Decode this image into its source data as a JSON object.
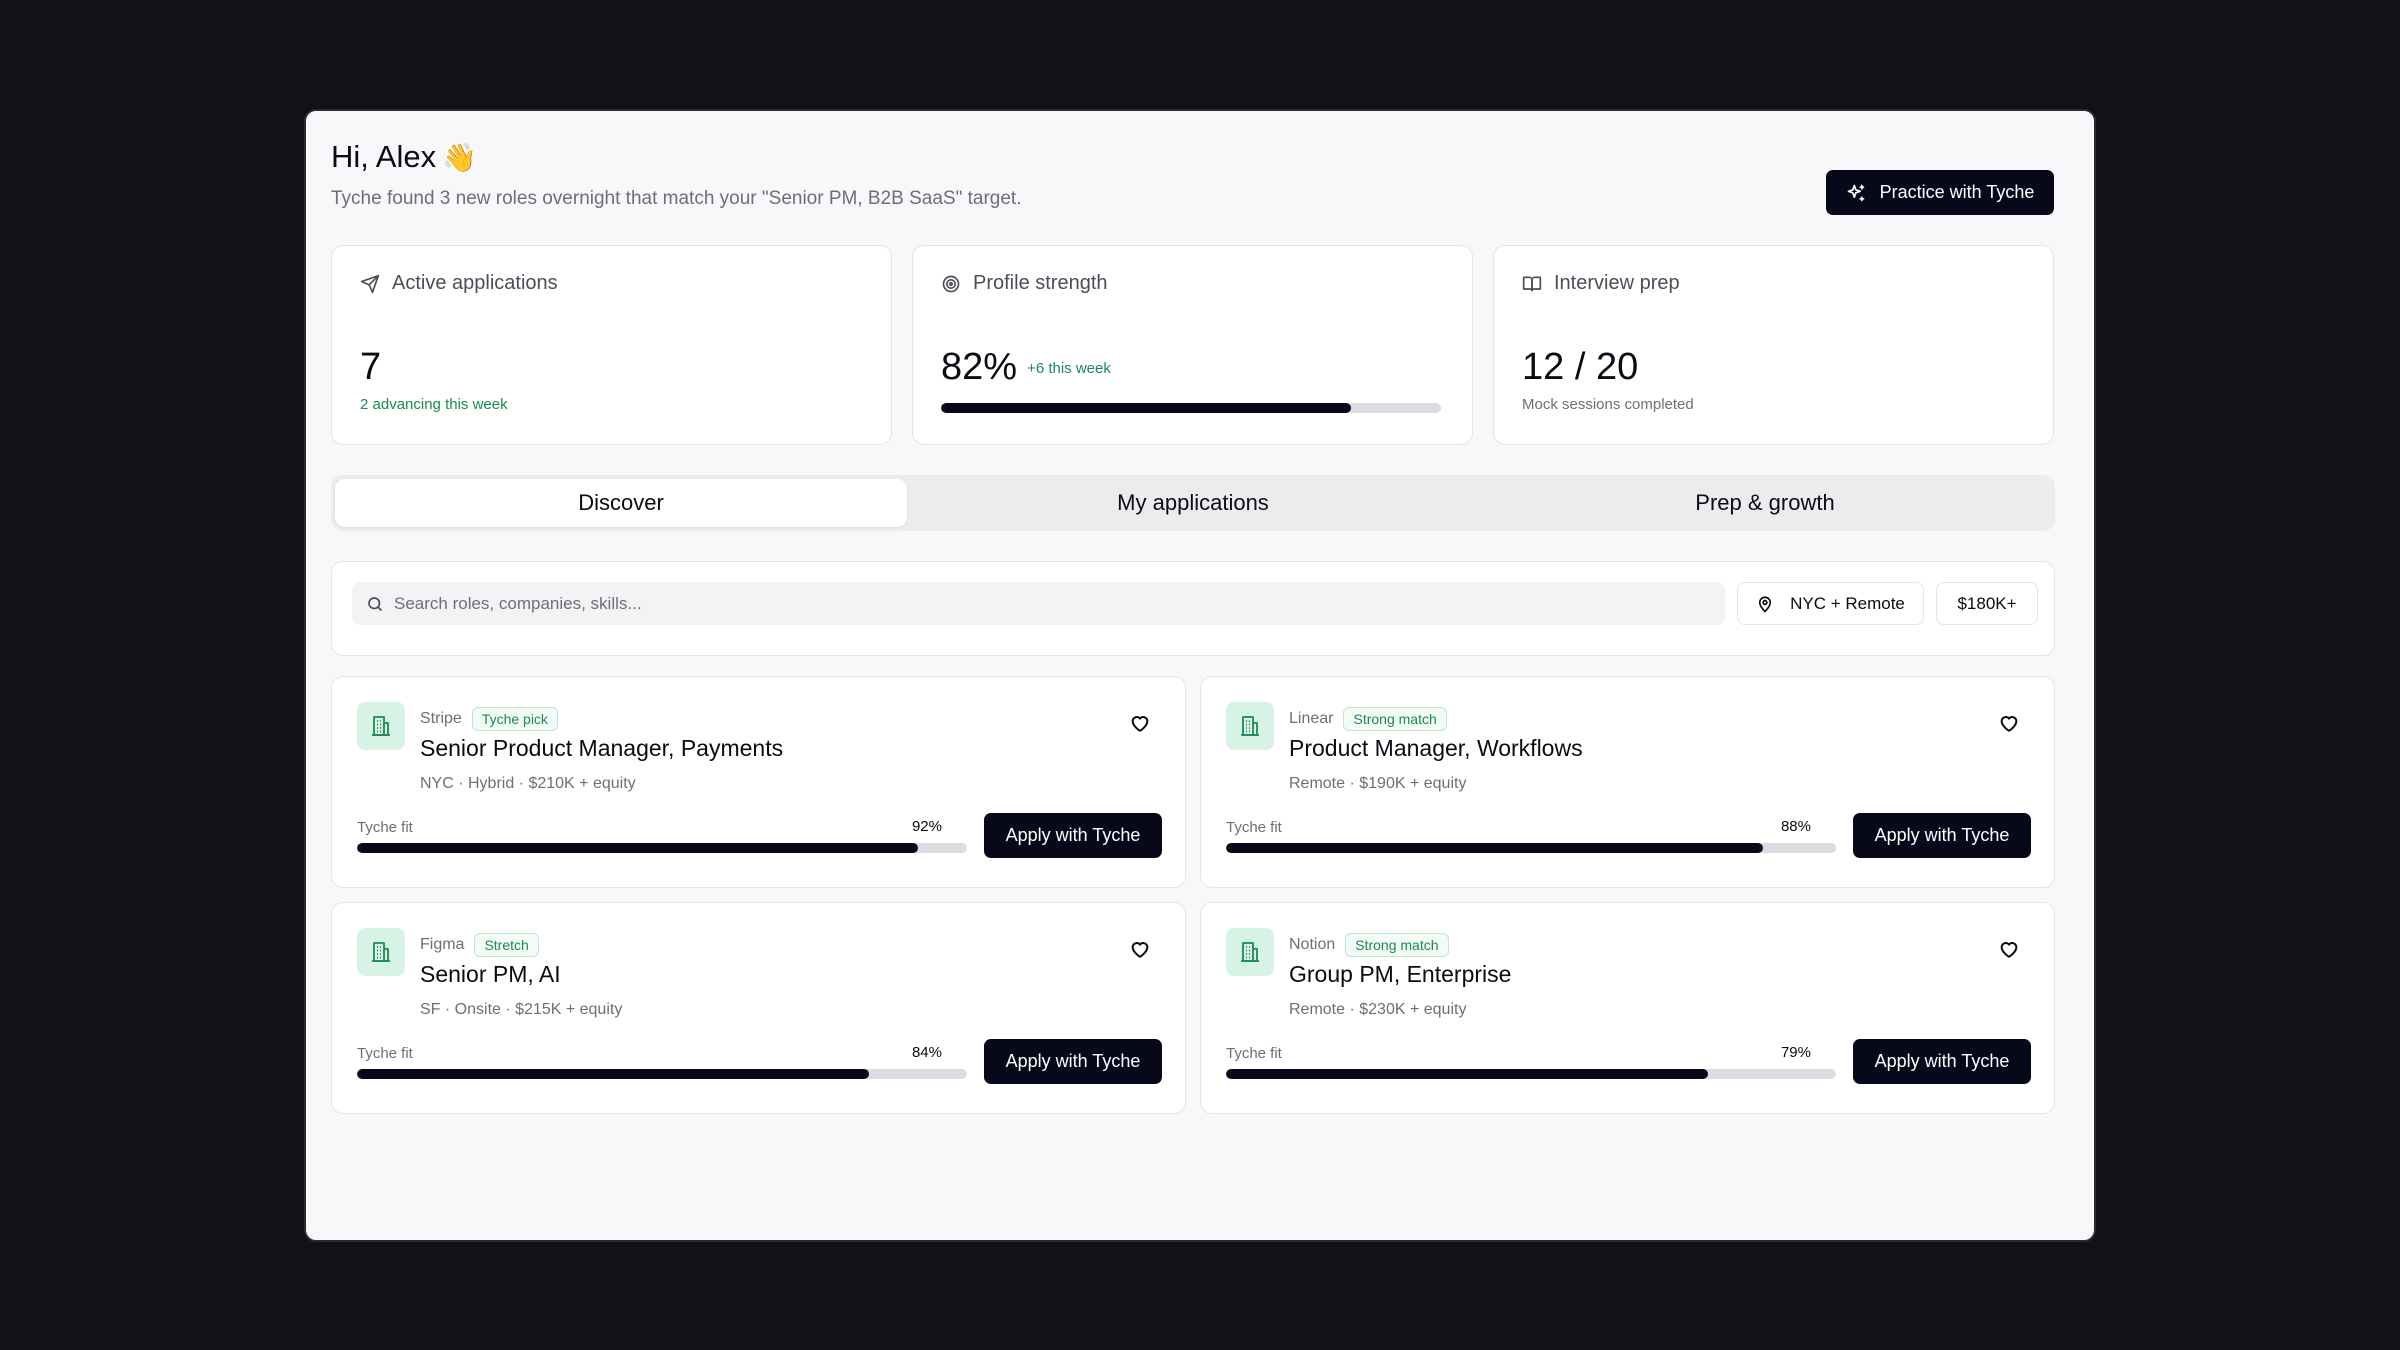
{
  "header": {
    "greeting": "Hi, Alex",
    "wave": "👋",
    "subtitle": "Tyche found 3 new roles overnight that match your \"Senior PM, B2B SaaS\" target.",
    "practice_label": "Practice with Tyche"
  },
  "stats": {
    "active": {
      "label": "Active applications",
      "value": "7",
      "note": "2 advancing this week"
    },
    "profile": {
      "label": "Profile strength",
      "value": "82%",
      "delta": "+6 this week",
      "progress": 0.82
    },
    "prep": {
      "label": "Interview prep",
      "value": "12 / 20",
      "note": "Mock sessions completed"
    }
  },
  "tabs": [
    {
      "label": "Discover",
      "active": true
    },
    {
      "label": "My applications",
      "active": false
    },
    {
      "label": "Prep & growth",
      "active": false
    }
  ],
  "search": {
    "placeholder": "Search roles, companies, skills...",
    "location": "NYC + Remote",
    "salary": "$180K+"
  },
  "jobs": [
    {
      "company": "Stripe",
      "badge": "Tyche pick",
      "title": "Senior Product Manager, Payments",
      "meta": "NYC · Hybrid · $210K + equity",
      "fit_label": "Tyche fit",
      "fit_pct": "92%",
      "fit": 0.92,
      "apply": "Apply with Tyche"
    },
    {
      "company": "Linear",
      "badge": "Strong match",
      "title": "Product Manager, Workflows",
      "meta": "Remote · $190K + equity",
      "fit_label": "Tyche fit",
      "fit_pct": "88%",
      "fit": 0.88,
      "apply": "Apply with Tyche"
    },
    {
      "company": "Figma",
      "badge": "Stretch",
      "title": "Senior PM, AI",
      "meta": "SF · Onsite · $215K + equity",
      "fit_label": "Tyche fit",
      "fit_pct": "84%",
      "fit": 0.84,
      "apply": "Apply with Tyche"
    },
    {
      "company": "Notion",
      "badge": "Strong match",
      "title": "Group PM, Enterprise",
      "meta": "Remote · $230K + equity",
      "fit_label": "Tyche fit",
      "fit_pct": "79%",
      "fit": 0.79,
      "apply": "Apply with Tyche"
    }
  ],
  "colors": {
    "accent_dark": "#07081a",
    "success_green": "#1c8a52",
    "logo_bg": "#d7f3e6"
  }
}
